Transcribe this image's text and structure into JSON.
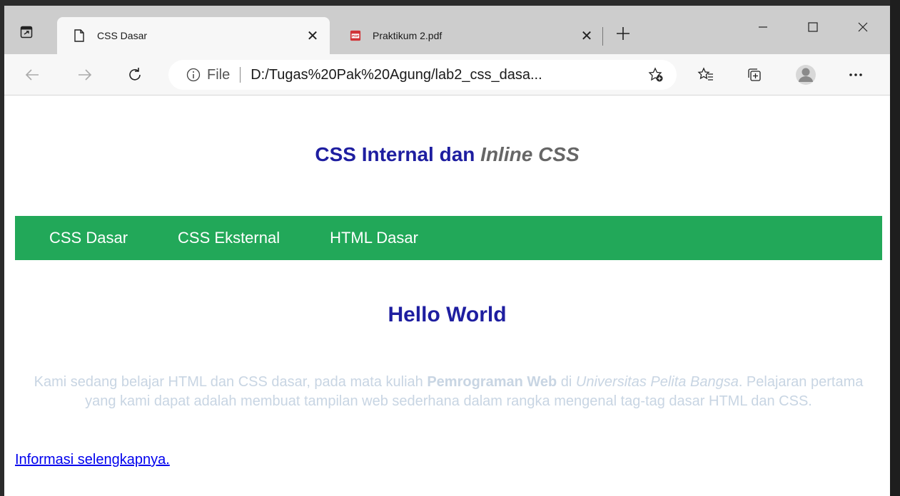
{
  "browser": {
    "tabs": [
      {
        "title": "CSS Dasar",
        "icon": "page-icon",
        "active": true
      },
      {
        "title": "Praktikum 2.pdf",
        "icon": "pdf-icon",
        "active": false
      }
    ],
    "address": {
      "info_label": "File",
      "url": "D:/Tugas%20Pak%20Agung/lab2_css_dasa..."
    }
  },
  "page": {
    "title_main": "CSS Internal dan ",
    "title_em": "Inline CSS",
    "nav": [
      "CSS Dasar",
      "CSS Eksternal",
      "HTML Dasar"
    ],
    "heading": "Hello World",
    "paragraph": {
      "part1": "Kami sedang belajar HTML dan CSS dasar, pada mata kuliah ",
      "bold": "Pemrograman Web",
      "part2": " di ",
      "italic": "Universitas Pelita Bangsa",
      "part3": ". Pelajaran pertama yang kami dapat adalah membuat tampilan web sederhana dalam rangka mengenal tag-tag dasar HTML dan CSS."
    },
    "more_link": "Informasi selengkapnya."
  },
  "colors": {
    "nav_bg": "#22a859",
    "heading": "#1e1ea0",
    "paragraph": "#c8d5e3",
    "link": "#0000ee"
  }
}
